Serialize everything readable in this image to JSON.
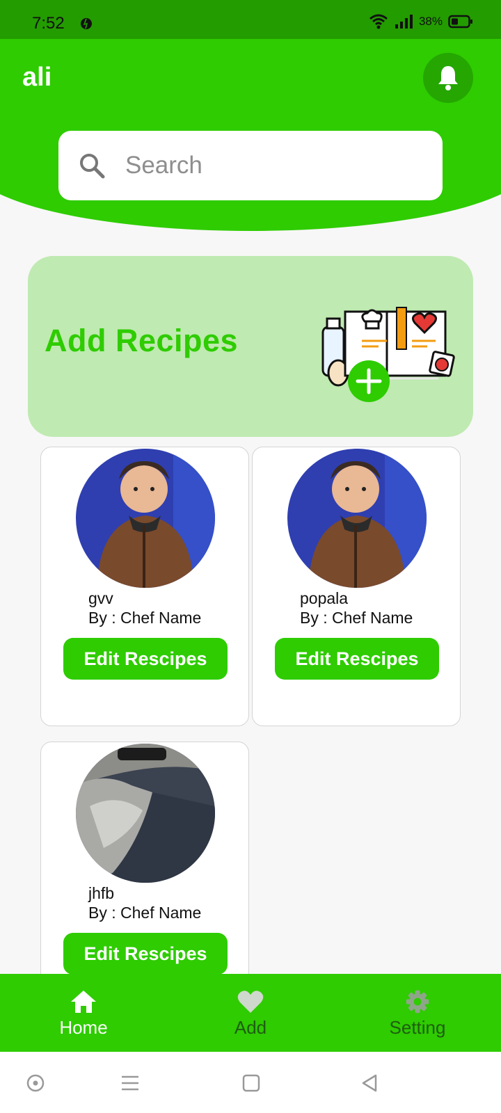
{
  "status_bar": {
    "time": "7:52",
    "battery": "38%",
    "icons": [
      "wifi-icon",
      "signal-icon",
      "battery-icon"
    ]
  },
  "header": {
    "user_name": "ali",
    "search_placeholder": "Search"
  },
  "banner": {
    "title": "Add Recipes"
  },
  "recipes": [
    {
      "name": "gvv",
      "author": "By : Chef Name",
      "button": "Edit Rescipes"
    },
    {
      "name": "popala",
      "author": "By : Chef Name",
      "button": "Edit Rescipes"
    },
    {
      "name": "jhfb",
      "author": "By : Chef Name",
      "button": "Edit Rescipes"
    }
  ],
  "bottom_nav": [
    {
      "label": "Home",
      "icon": "home-icon",
      "active": true
    },
    {
      "label": "Add",
      "icon": "heart-icon",
      "active": false
    },
    {
      "label": "Setting",
      "icon": "gear-icon",
      "active": false
    }
  ],
  "colors": {
    "brand_green": "#2ecc00",
    "status_green": "#239c00",
    "banner_bg": "#bfeab1",
    "inactive_nav_text": "#1f5e10"
  }
}
